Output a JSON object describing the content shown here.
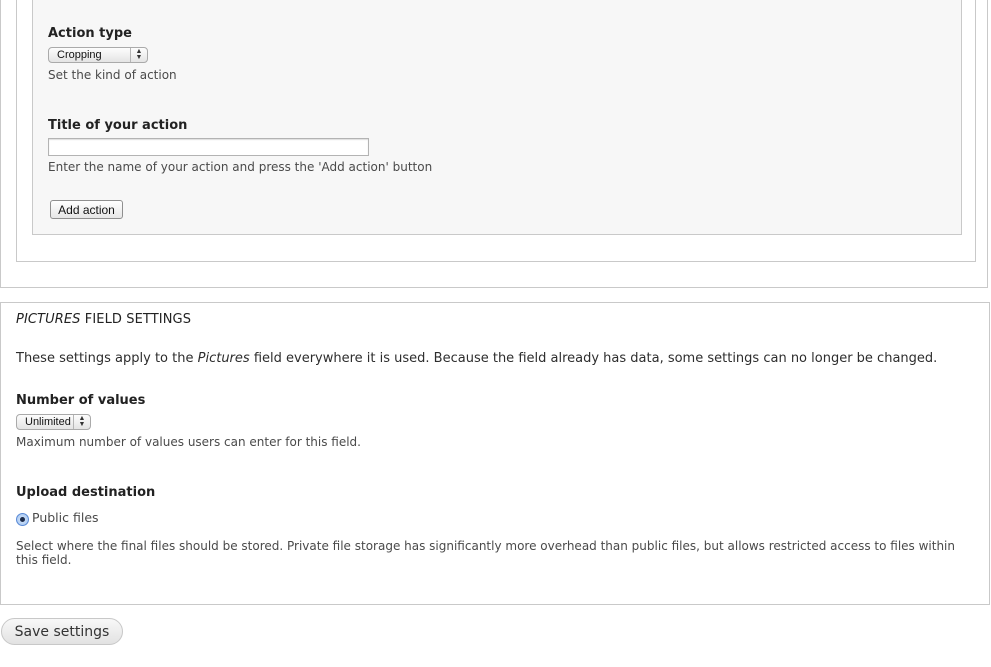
{
  "action_form": {
    "action_type_label": "Action type",
    "action_type_value": "Cropping",
    "action_type_desc": "Set the kind of action",
    "title_label": "Title of your action",
    "title_value": "",
    "title_desc": "Enter the name of your action and press the 'Add action' button",
    "add_button": "Add action"
  },
  "field_settings": {
    "legend_italic": "PICTURES",
    "legend_rest": " FIELD SETTINGS",
    "intro_prefix": "These settings apply to the ",
    "intro_field": "Pictures",
    "intro_suffix": " field everywhere it is used. Because the field already has data, some settings can no longer be changed.",
    "num_values_label": "Number of values",
    "num_values_value": "Unlimited",
    "num_values_desc": "Maximum number of values users can enter for this field.",
    "upload_label": "Upload destination",
    "upload_option": "Public files",
    "upload_desc": "Select where the final files should be stored. Private file storage has significantly more overhead than public files, but allows restricted access to files within this field."
  },
  "save_button": "Save settings"
}
